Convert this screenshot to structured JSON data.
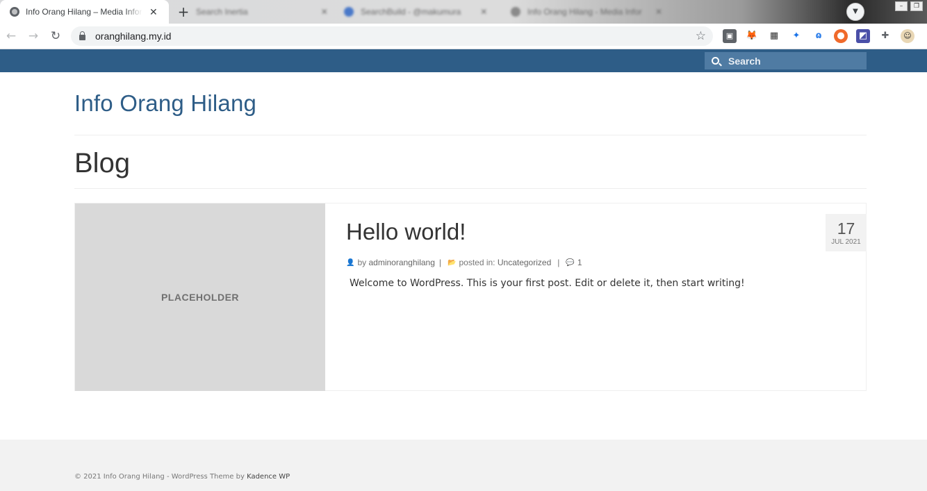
{
  "browser": {
    "active_tab_title": "Info Orang Hilang – Media Inform",
    "background_tabs": [
      "Search Inertia",
      "SearchBuild - @makumura",
      "Info Orang Hilang - Media Infor"
    ],
    "url": "oranghilang.my.id",
    "extensions": [
      "user-icon",
      "metamask-icon",
      "qr-icon",
      "star-ext-icon",
      "ext-wave-icon",
      "honey-icon",
      "ext-rss-icon",
      "puzzle-icon",
      "profile-avatar"
    ]
  },
  "header": {
    "search_placeholder": "Search"
  },
  "site": {
    "title": "Info Orang Hilang"
  },
  "page": {
    "title": "Blog"
  },
  "post": {
    "thumbnail_label": "PLACEHOLDER",
    "title": "Hello world!",
    "by_prefix": "by",
    "author": "adminoranghilang",
    "posted_in_prefix": "posted in:",
    "category": "Uncategorized",
    "comment_count": "1",
    "excerpt": "Welcome to WordPress. This is your first post. Edit or delete it, then start writing!",
    "date_day": "17",
    "date_month_year": "JUL 2021"
  },
  "footer": {
    "copyright": "© 2021 Info Orang Hilang - WordPress Theme by",
    "theme_link": "Kadence WP"
  },
  "colors": {
    "accent": "#2e5d87",
    "search_bg": "#4f7ba3",
    "footer_bg": "#f2f2f2"
  }
}
